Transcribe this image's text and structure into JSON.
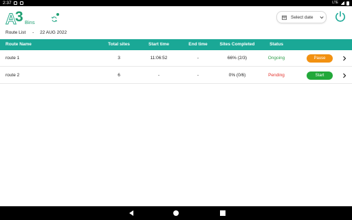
{
  "status_bar": {
    "time": "2:37",
    "network": "LTE"
  },
  "header": {
    "logo_letter": "A",
    "logo_number": "3",
    "logo_word": "Bins",
    "date_placeholder": "Select date"
  },
  "breadcrumb": {
    "page": "Route List",
    "separator": "-",
    "date": "22 AUG 2022"
  },
  "table": {
    "columns": [
      "Route Name",
      "Total sites",
      "Start time",
      "End time",
      "Sites Completed",
      "Status"
    ],
    "rows": [
      {
        "route_name": "route 1",
        "total_sites": "3",
        "start_time": "11:06:52",
        "end_time": "-",
        "sites_completed": "66% (2/3)",
        "status": "Ongoing",
        "action": "Pause"
      },
      {
        "route_name": "route 2",
        "total_sites": "6",
        "start_time": "-",
        "end_time": "-",
        "sites_completed": "0% (0/6)",
        "status": "Pending",
        "action": "Start"
      }
    ]
  },
  "colors": {
    "brand": "#1f9f72",
    "header_bar": "#1aa896",
    "ongoing": "#2e9d4a",
    "pending": "#e3332d",
    "pause_button": "#f29111",
    "start_button": "#22a83a"
  },
  "icons": {
    "sync": "sync-icon",
    "calendar": "calendar-icon",
    "dropdown": "chevron-down-icon",
    "power": "power-icon",
    "row": "chevron-right-icon"
  }
}
